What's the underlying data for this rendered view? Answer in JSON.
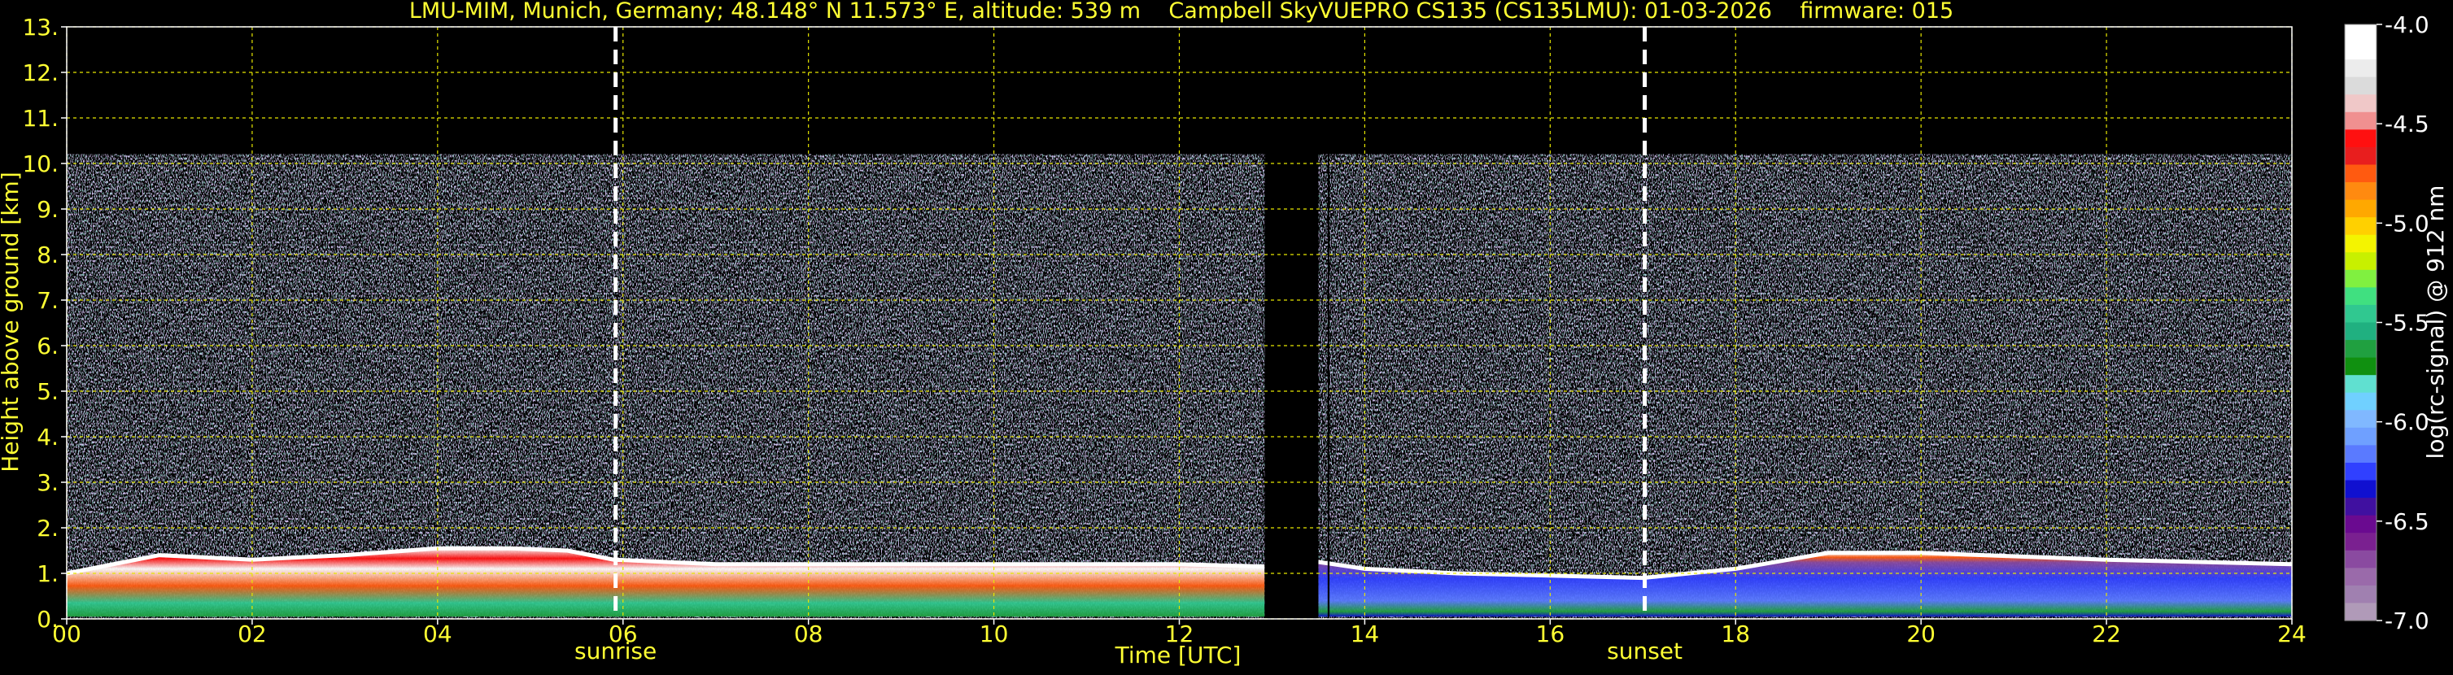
{
  "chart_data": {
    "type": "heatmap",
    "title": "LMU-MIM, Munich, Germany; 48.148° N 11.573° E, altitude: 539 m    Campbell SkyVUEPRO CS135 (CS135LMU): 01-03-2026    firmware: 015",
    "xlabel": "Time [UTC]",
    "ylabel": "Height above ground [km]",
    "xlim": [
      0,
      24
    ],
    "ylim": [
      0,
      13
    ],
    "x_ticks": [
      "00",
      "02",
      "04",
      "06",
      "08",
      "10",
      "12",
      "14",
      "16",
      "18",
      "20",
      "22",
      "24"
    ],
    "y_ticks": [
      "0.",
      "1.",
      "2.",
      "3.",
      "4.",
      "5.",
      "6.",
      "7.",
      "8.",
      "9.",
      "10.",
      "11.",
      "12.",
      "13."
    ],
    "grid": true,
    "colorbar": {
      "label": "log(rc-signal) @ 912 nm",
      "range": [
        -7.0,
        -4.0
      ],
      "ticks": [
        "-4.0",
        "-4.5",
        "-5.0",
        "-5.5",
        "-6.0",
        "-6.5",
        "-7.0"
      ],
      "colors_top_to_bottom": [
        "#ffffff",
        "#ffffff",
        "#ececec",
        "#dbdbdb",
        "#f0c8c8",
        "#f09090",
        "#ff1010",
        "#e81e1e",
        "#ff5a10",
        "#ff8a10",
        "#ffa800",
        "#ffd000",
        "#f4f400",
        "#c8f000",
        "#80f040",
        "#40e080",
        "#30c890",
        "#20b080",
        "#20a040",
        "#109010",
        "#60e0d0",
        "#70d0ff",
        "#80b8ff",
        "#6fa0ff",
        "#5a7aff",
        "#3040ff",
        "#1010d0",
        "#4010a0",
        "#6a0a90",
        "#7a2090",
        "#8a4aa0",
        "#9a6aaa",
        "#a080b0",
        "#b09ab8"
      ]
    },
    "annotations": [
      {
        "label": "sunrise",
        "x": 5.92
      },
      {
        "label": "sunset",
        "x": 17.02
      }
    ],
    "data_gaps": [
      [
        12.92,
        13.5
      ],
      [
        13.6,
        13.62
      ]
    ],
    "cloud_top_km": [
      10.2,
      10.2
    ],
    "layers": [
      {
        "name": "",
        "x": [
          0,
          1,
          2,
          3,
          4,
          4.8,
          5.4,
          5.9,
          7,
          8,
          10,
          12,
          12.92
        ],
        "bottom": [
          0.05,
          0.05,
          0.05,
          0.05,
          0.05,
          0.05,
          0.05,
          0.05,
          0.05,
          0.05,
          0.05,
          0.05,
          0.05
        ],
        "top": [
          1.0,
          1.4,
          1.3,
          1.4,
          1.55,
          1.55,
          1.5,
          1.3,
          1.2,
          1.2,
          1.2,
          1.2,
          1.15
        ]
      },
      {
        "name": "",
        "x": [
          13.5,
          14,
          15,
          16,
          17,
          18,
          19,
          20,
          22,
          24
        ],
        "bottom": [
          0.05,
          0.05,
          0.05,
          0.05,
          0.05,
          0.05,
          0.05,
          0.05,
          0.05,
          0.05
        ],
        "top": [
          1.25,
          1.1,
          1.0,
          0.95,
          0.9,
          1.1,
          1.45,
          1.45,
          1.3,
          1.2
        ]
      }
    ]
  }
}
